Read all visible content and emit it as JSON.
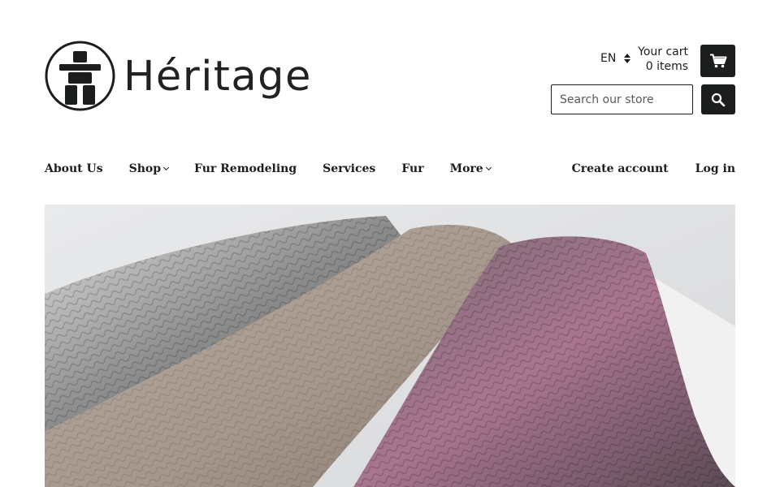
{
  "header": {
    "logo_text": "Héritage",
    "language": "EN",
    "cart": {
      "label": "Your cart",
      "count": "0 items"
    },
    "search": {
      "placeholder": "Search our store"
    }
  },
  "nav": {
    "items": [
      {
        "label": "About Us",
        "has_dropdown": false
      },
      {
        "label": "Shop",
        "has_dropdown": true
      },
      {
        "label": "Fur Remodeling",
        "has_dropdown": false
      },
      {
        "label": "Services",
        "has_dropdown": false
      },
      {
        "label": "Fur",
        "has_dropdown": false
      },
      {
        "label": "More",
        "has_dropdown": true
      }
    ],
    "account": {
      "create": "Create account",
      "login": "Log in"
    }
  },
  "colors": {
    "text": "#1c1d1d",
    "button_bg": "#1c1d1d",
    "fur_grey": "#9a9a9a",
    "fur_taupe": "#a6978c",
    "fur_pink": "#a9758f"
  },
  "icons": [
    "inukshuk-logo-icon",
    "cart-icon",
    "search-icon",
    "sort-arrows-icon",
    "chevron-down-icon"
  ]
}
